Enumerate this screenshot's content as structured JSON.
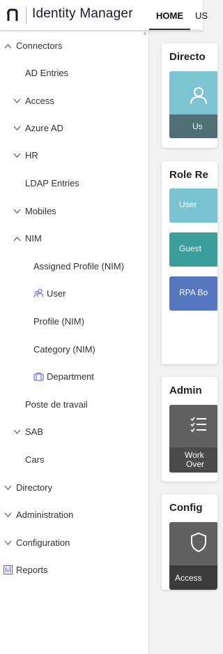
{
  "header": {
    "logo_text": "Identity Manager",
    "tabs": [
      {
        "label": "HOME",
        "active": true
      },
      {
        "label": "US",
        "active": false
      }
    ]
  },
  "sidebar": {
    "items": [
      {
        "label": "Connectors",
        "chevron": "up"
      },
      {
        "label": "AD Entries",
        "chevron": "none"
      },
      {
        "label": "Access",
        "chevron": "down"
      },
      {
        "label": "Azure AD",
        "chevron": "down"
      },
      {
        "label": "HR",
        "chevron": "down"
      },
      {
        "label": "LDAP Entries",
        "chevron": "none"
      },
      {
        "label": "Mobiles",
        "chevron": "down"
      },
      {
        "label": "NIM",
        "chevron": "up"
      },
      {
        "label": "Assigned Profile (NIM)",
        "chevron": "none"
      },
      {
        "label": "User",
        "icon": "users-icon"
      },
      {
        "label": "Profile (NIM)",
        "chevron": "none"
      },
      {
        "label": "Category (NIM)",
        "chevron": "none"
      },
      {
        "label": "Department",
        "icon": "briefcase-icon"
      },
      {
        "label": "Poste de travail",
        "chevron": "none"
      },
      {
        "label": "SAB",
        "chevron": "down"
      },
      {
        "label": "Cars",
        "chevron": "none"
      },
      {
        "label": "Directory",
        "chevron": "down"
      },
      {
        "label": "Administration",
        "chevron": "down"
      },
      {
        "label": "Configuration",
        "chevron": "down"
      },
      {
        "label": "Reports",
        "icon": "reports-icon"
      }
    ]
  },
  "main": {
    "cards": [
      {
        "title": "Directo",
        "tiles": [
          {
            "label": "Us",
            "color": "#7cc4d2",
            "footer_color": "#4f6e75",
            "icon": "user-icon"
          }
        ]
      },
      {
        "title": "Role Re",
        "tiles": [
          {
            "label": "User",
            "color": "#79c4d3"
          },
          {
            "label": "Guest",
            "color": "#3a9e9b"
          },
          {
            "label": "RPA Bo",
            "color": "#5577bd"
          }
        ]
      },
      {
        "title": "Admin",
        "tiles": [
          {
            "label": "Work Over",
            "line1": "Work",
            "line2": "Over",
            "color": "#616161",
            "footer_color": "#4a4a4a",
            "icon": "list-check-icon"
          }
        ]
      },
      {
        "title": "Config",
        "tiles": [
          {
            "label": "Access",
            "color": "#616161",
            "footer_color": "#3b3b3b",
            "icon": "shield-icon"
          }
        ]
      }
    ]
  },
  "colors": {
    "accent": "#333333",
    "icon_purple": "#5a5fd6",
    "sidebar_bg": "#ffffff",
    "page_bg": "#f2f2f2"
  }
}
